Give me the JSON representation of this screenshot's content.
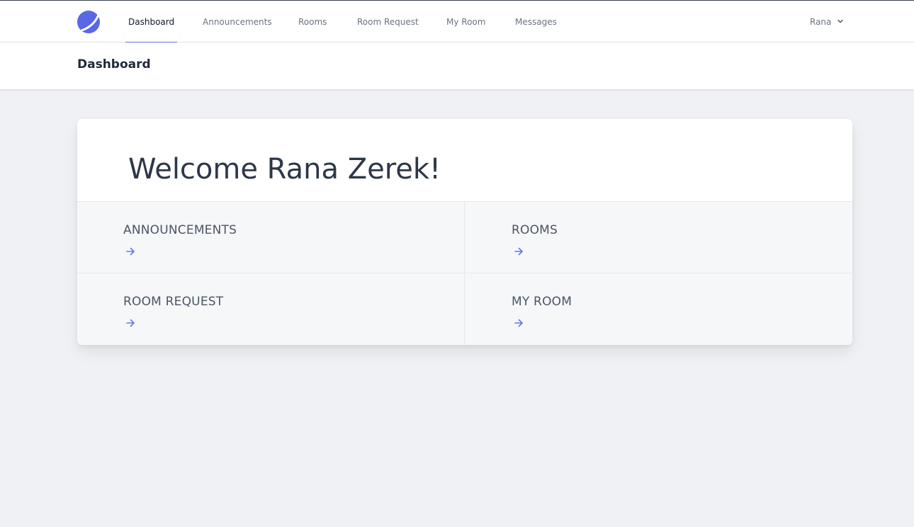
{
  "nav": {
    "items": [
      {
        "label": "Dashboard",
        "active": true
      },
      {
        "label": "Announcements",
        "active": false
      },
      {
        "label": "Rooms",
        "active": false
      },
      {
        "label": "Room Request",
        "active": false
      },
      {
        "label": "My Room",
        "active": false
      },
      {
        "label": "Messages",
        "active": false
      }
    ],
    "user_label": "Rana",
    "logo_icon": "crescent-logo-icon",
    "user_menu_icon": "chevron-down-icon"
  },
  "header": {
    "title": "Dashboard"
  },
  "welcome": {
    "text": "Welcome Rana Zerek!"
  },
  "tiles": [
    {
      "label": "ANNOUNCEMENTS",
      "icon": "arrow-right-icon"
    },
    {
      "label": "ROOMS",
      "icon": "arrow-right-icon"
    },
    {
      "label": "ROOM REQUEST",
      "icon": "arrow-right-icon"
    },
    {
      "label": "MY ROOM",
      "icon": "arrow-right-icon"
    }
  ],
  "colors": {
    "accent": "#6875e8",
    "background": "#f0f1f5",
    "tile_background": "#f6f7f9"
  }
}
